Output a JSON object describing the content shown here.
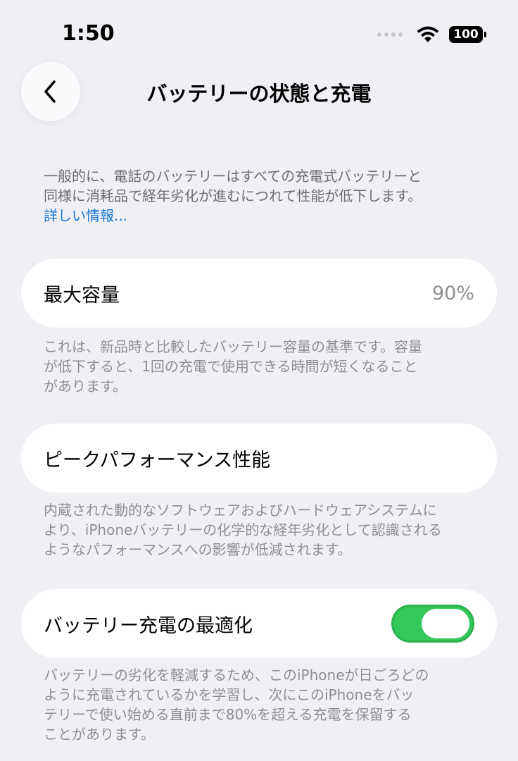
{
  "status_bar": {
    "time": "1:50",
    "battery": "100"
  },
  "nav": {
    "title": "バッテリーの状態と充電",
    "back_icon": "chevron-left-icon"
  },
  "intro": {
    "line1": "一般的に、電話のバッテリーはすべての充電式バッテリーと",
    "line2": "同様に消耗品で経年劣化が進むにつれて性能が低下します。",
    "link": "詳しい情報..."
  },
  "max_capacity": {
    "label": "最大容量",
    "value": "90%",
    "footnote_line1": "これは、新品時と比較したバッテリー容量の基準です。容量",
    "footnote_line2": "が低下すると、1回の充電で使用できる時間が短くなること",
    "footnote_line3": "があります。"
  },
  "peak_performance": {
    "label": "ピークパフォーマンス性能",
    "footnote_line1": "内蔵された動的なソフトウェアおよびハードウェアシステムに",
    "footnote_line2": "より、iPhoneバッテリーの化学的な経年劣化として認識される",
    "footnote_line3": "ようなパフォーマンスへの影響が低減されます。"
  },
  "optimized_charging": {
    "label": "バッテリー充電の最適化",
    "enabled": true,
    "footnote_line1": "バッテリーの劣化を軽減するため、このiPhoneが日ごろどの",
    "footnote_line2": "ように充電されているかを学習し、次にこのiPhoneをバッ",
    "footnote_line3": "テリーで使い始める直前まで80%を超える充電を保留する",
    "footnote_line4": "ことがあります。"
  },
  "colors": {
    "background": "#efeff4",
    "link": "#1a78d6",
    "toggle_on": "#34c759",
    "secondary_text": "#8e8e93"
  }
}
